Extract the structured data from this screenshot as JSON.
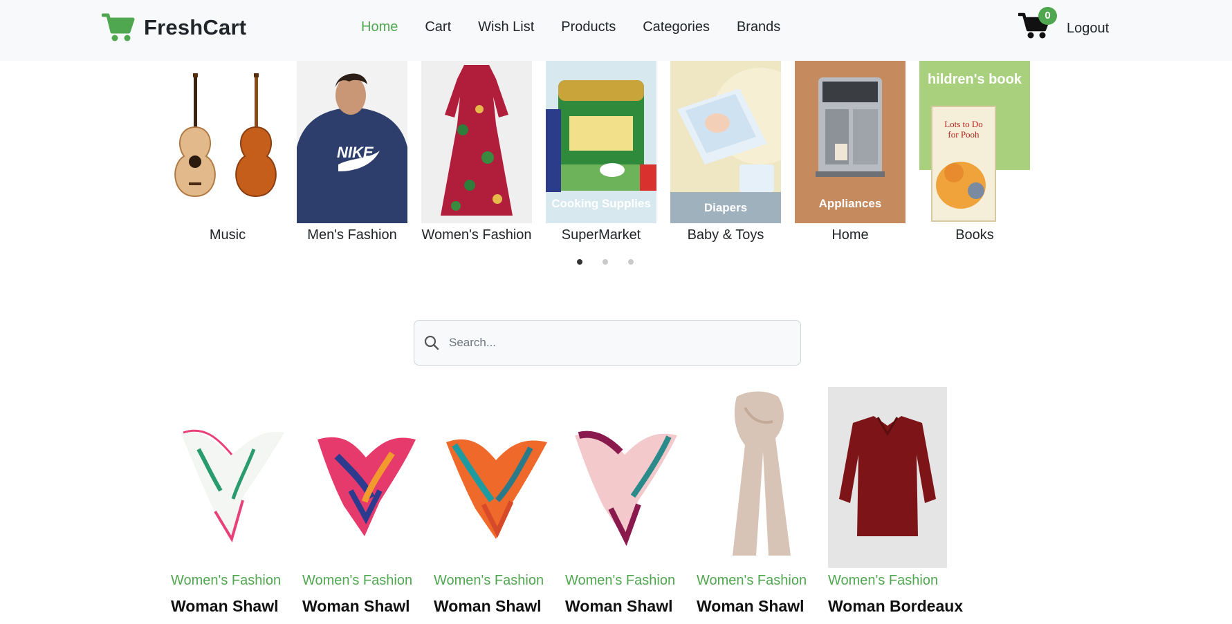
{
  "brand": {
    "name": "FreshCart",
    "color": "#4fa74f"
  },
  "nav": {
    "links": [
      "Home",
      "Cart",
      "Wish List",
      "Products",
      "Categories",
      "Brands"
    ],
    "active": "Home",
    "cart_count": "0",
    "logout": "Logout"
  },
  "categories": [
    {
      "label": "Music"
    },
    {
      "label": "Men's Fashion"
    },
    {
      "label": "Women's Fashion"
    },
    {
      "label": "SuperMarket",
      "overlay": "Cooking Supplies"
    },
    {
      "label": "Baby & Toys",
      "overlay": "Diapers"
    },
    {
      "label": "Home",
      "overlay": "Appliances"
    },
    {
      "label": "Books",
      "overlay": "hildren's book"
    }
  ],
  "slider": {
    "dots": 3,
    "active_dot": 1
  },
  "search": {
    "placeholder": "Search..."
  },
  "products": [
    {
      "category": "Women's Fashion",
      "title": "Woman Shawl"
    },
    {
      "category": "Women's Fashion",
      "title": "Woman Shawl"
    },
    {
      "category": "Women's Fashion",
      "title": "Woman Shawl"
    },
    {
      "category": "Women's Fashion",
      "title": "Woman Shawl"
    },
    {
      "category": "Women's Fashion",
      "title": "Woman Shawl"
    },
    {
      "category": "Women's Fashion",
      "title": "Woman Bordeaux"
    }
  ],
  "colors": {
    "accent": "#4fa74f",
    "navbar_bg": "#f8f9fa",
    "text": "#212529"
  }
}
